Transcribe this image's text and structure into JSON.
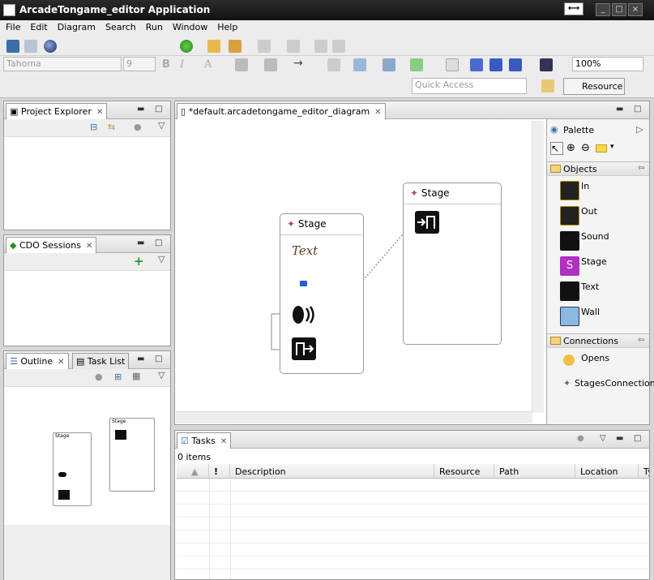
{
  "window": {
    "title": "ArcadeTongame_editor Application"
  },
  "menu": [
    "File",
    "Edit",
    "Diagram",
    "Search",
    "Run",
    "Window",
    "Help"
  ],
  "format_toolbar": {
    "font": "Tahoma",
    "size": "9",
    "zoom": "100%"
  },
  "quick_access": {
    "placeholder": "Quick Access"
  },
  "perspective": {
    "label": "Resource"
  },
  "views": {
    "project_explorer": "Project Explorer",
    "cdo_sessions": "CDO Sessions",
    "outline": "Outline",
    "task_list": "Task List",
    "tasks": "Tasks"
  },
  "editor": {
    "tab": "*default.arcadetongame_editor_diagram",
    "stages": [
      {
        "label": "Stage",
        "text_label": "Text"
      },
      {
        "label": "Stage"
      }
    ],
    "outline_stages": [
      {
        "label": "Stage"
      },
      {
        "label": "Stage"
      }
    ]
  },
  "palette": {
    "title": "Palette",
    "groups": [
      {
        "name": "Objects",
        "items": [
          "In",
          "Out",
          "Sound",
          "Stage",
          "Text",
          "Wall"
        ]
      },
      {
        "name": "Connections",
        "items": [
          "Opens",
          "StagesConnection"
        ]
      }
    ]
  },
  "tasks": {
    "count_label": "0 items",
    "columns": [
      "!",
      "Description",
      "Resource",
      "Path",
      "Location",
      "Ty"
    ]
  }
}
